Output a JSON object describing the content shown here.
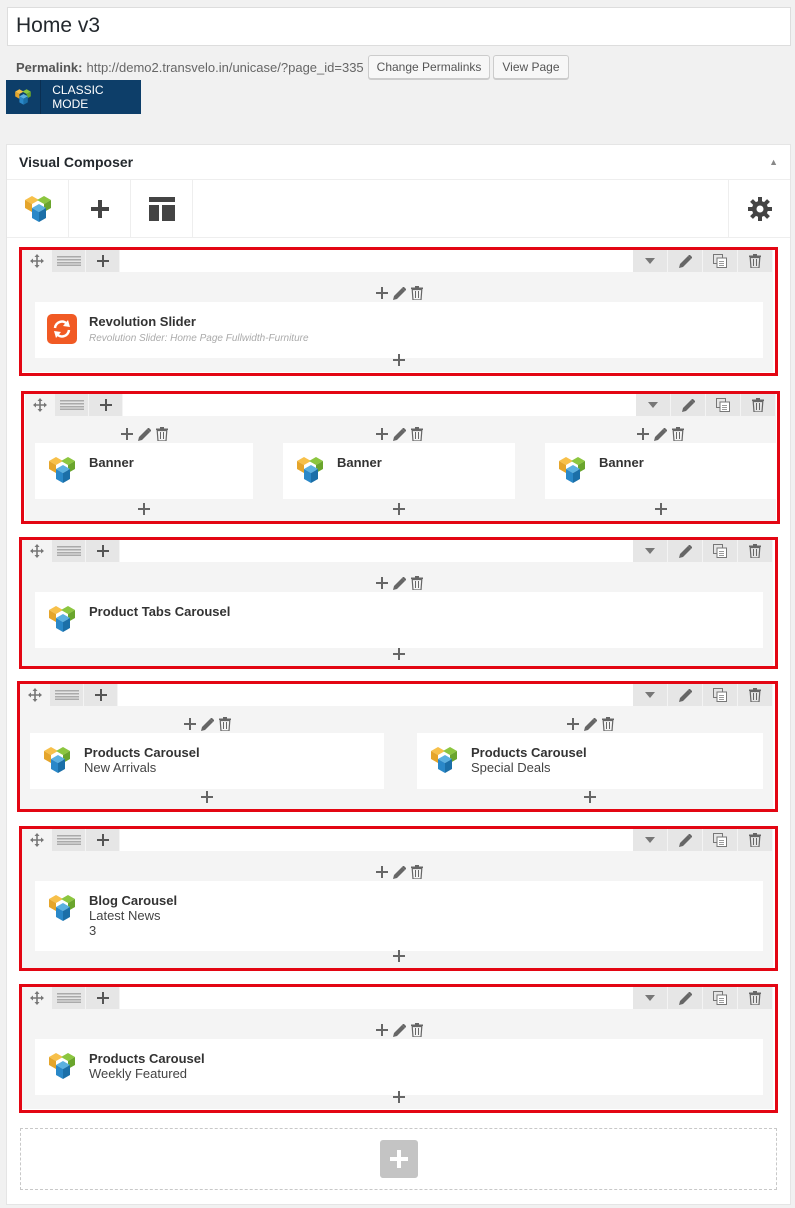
{
  "page": {
    "title": "Home v3",
    "permalink_label": "Permalink:",
    "permalink_url": "http://demo2.transvelo.in/unicase/?page_id=335",
    "change_permalinks": "Change Permalinks",
    "view_page": "View Page",
    "classic_mode": "CLASSIC MODE"
  },
  "composer": {
    "title": "Visual Composer"
  },
  "rows": [
    {
      "columns": [
        {
          "elements": [
            {
              "icon": "revolution-slider-icon",
              "title": "Revolution Slider",
              "subtitle": "Revolution Slider: Home Page Fullwidth-Furniture",
              "subtitle_italic": true
            }
          ]
        }
      ]
    },
    {
      "columns": [
        {
          "elements": [
            {
              "icon": "vc-logo-icon",
              "title": "Banner"
            }
          ]
        },
        {
          "elements": [
            {
              "icon": "vc-logo-icon",
              "title": "Banner"
            }
          ]
        },
        {
          "elements": [
            {
              "icon": "vc-logo-icon",
              "title": "Banner"
            }
          ]
        }
      ]
    },
    {
      "columns": [
        {
          "elements": [
            {
              "icon": "vc-logo-icon",
              "title": "Product Tabs Carousel"
            }
          ]
        }
      ]
    },
    {
      "columns": [
        {
          "elements": [
            {
              "icon": "vc-logo-icon",
              "title": "Products Carousel",
              "lines": [
                "New Arrivals"
              ]
            }
          ]
        },
        {
          "elements": [
            {
              "icon": "vc-logo-icon",
              "title": "Products Carousel",
              "lines": [
                "Special Deals"
              ]
            }
          ]
        }
      ]
    },
    {
      "columns": [
        {
          "elements": [
            {
              "icon": "vc-logo-icon",
              "title": "Blog Carousel",
              "lines": [
                "Latest News",
                "3"
              ]
            }
          ]
        }
      ]
    },
    {
      "columns": [
        {
          "elements": [
            {
              "icon": "vc-logo-icon",
              "title": "Products Carousel",
              "lines": [
                "Weekly Featured"
              ]
            }
          ]
        }
      ]
    }
  ],
  "colors": {
    "highlight_border": "#e30613",
    "classic_button": "#0d3e69",
    "revolution_icon": "#f15a24"
  }
}
